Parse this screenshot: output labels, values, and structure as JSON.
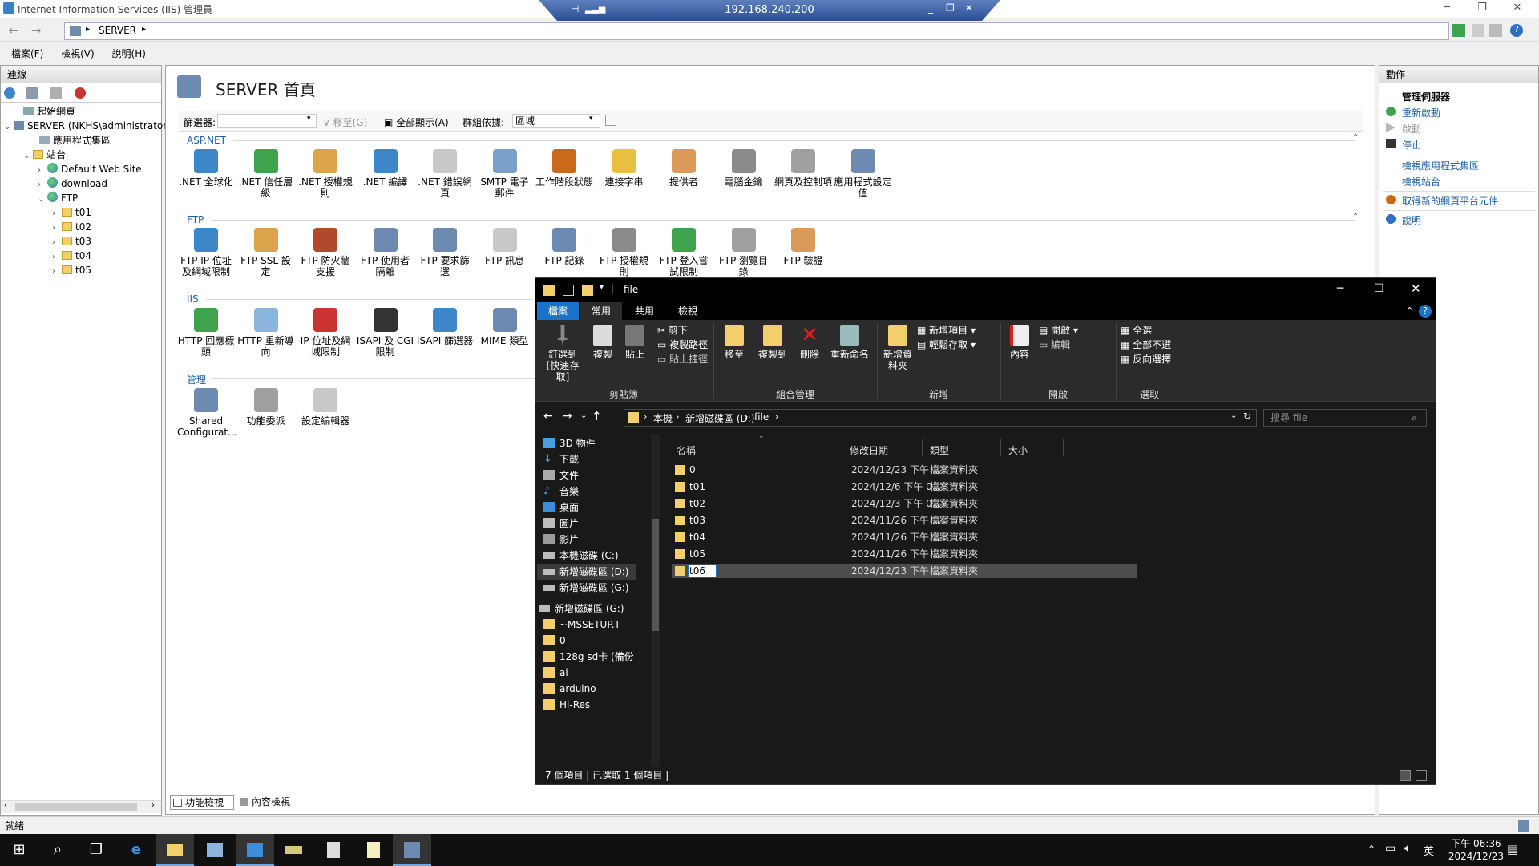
{
  "iis": {
    "title": "Internet Information Services (IIS) 管理員",
    "rdp_ip": "192.168.240.200",
    "address_path": "SERVER",
    "menu": [
      "檔案(F)",
      "檢視(V)",
      "說明(H)"
    ],
    "connections": {
      "header": "連線",
      "tree": [
        {
          "label": "起始網頁",
          "level": 1
        },
        {
          "label": "SERVER (NKHS\\administrator)",
          "level": 0
        },
        {
          "label": "應用程式集區",
          "level": 2
        },
        {
          "label": "站台",
          "level": 1
        },
        {
          "label": "Default Web Site",
          "level": 2
        },
        {
          "label": "download",
          "level": 2
        },
        {
          "label": "FTP",
          "level": 2
        },
        {
          "label": "t01",
          "level": 3
        },
        {
          "label": "t02",
          "level": 3
        },
        {
          "label": "t03",
          "level": 3
        },
        {
          "label": "t04",
          "level": 3
        },
        {
          "label": "t05",
          "level": 3
        }
      ]
    },
    "center": {
      "title": "SERVER 首頁",
      "filter_label": "篩選器:",
      "goto_label": "移至(G)",
      "show_all_label": "全部顯示(A)",
      "group_by_label": "群組依據:",
      "group_by_value": "區域",
      "sections": {
        "aspnet": {
          "label": "ASP.NET",
          "items": [
            ".NET 全球化",
            ".NET 信任層級",
            ".NET 授權規則",
            ".NET 編譯",
            ".NET 錯誤網頁",
            "SMTP 電子郵件",
            "工作階段狀態",
            "連接字串",
            "提供者",
            "電腦金鑰",
            "網頁及控制項",
            "應用程式設定值"
          ]
        },
        "ftp": {
          "label": "FTP",
          "items": [
            "FTP IP 位址及網域限制",
            "FTP SSL 設定",
            "FTP 防火牆支援",
            "FTP 使用者隔離",
            "FTP 要求篩選",
            "FTP 訊息",
            "FTP 記錄",
            "FTP 授權規則",
            "FTP 登入嘗試限制",
            "FTP 瀏覽目錄",
            "FTP 驗證"
          ]
        },
        "iis": {
          "label": "IIS",
          "items": [
            "HTTP 回應標頭",
            "HTTP 重新導向",
            "IP 位址及網域限制",
            "ISAPI 及 CGI 限制",
            "ISAPI 篩選器",
            "MIME 類型"
          ]
        },
        "mgmt": {
          "label": "管理",
          "items": [
            "Shared Configurat...",
            "功能委派",
            "設定編輯器"
          ]
        }
      },
      "bottom_tabs": [
        "功能檢視",
        "內容檢視"
      ]
    },
    "actions": {
      "header": "動作",
      "group_title": "管理伺服器",
      "items": [
        "重新啟動",
        "啟動",
        "停止",
        "檢視應用程式集區",
        "檢視站台",
        "取得新的網頁平台元件",
        "說明"
      ]
    },
    "status": "就緒"
  },
  "explorer": {
    "title": "file",
    "tabs": [
      "檔案",
      "常用",
      "共用",
      "檢視"
    ],
    "ribbon": {
      "pin": "釘選到 [快速存取]",
      "copy": "複製",
      "paste": "貼上",
      "cut": "剪下",
      "copy_path": "複製路徑",
      "paste_shortcut": "貼上捷徑",
      "clipboard": "剪貼簿",
      "move_to": "移至",
      "copy_to": "複製到",
      "delete": "刪除",
      "rename": "重新命名",
      "organize": "組合管理",
      "new_folder": "新增資料夾",
      "new_item": "新增項目",
      "easy_access": "輕鬆存取",
      "new_group": "新增",
      "properties": "內容",
      "open": "開啟",
      "edit": "編輯",
      "open_group": "開啟",
      "select_all": "全選",
      "select_none": "全部不選",
      "invert": "反向選擇",
      "select_group": "選取"
    },
    "path": [
      "本機",
      "新增磁碟區 (D:)",
      "file"
    ],
    "search_placeholder": "搜尋 file",
    "nav": [
      "3D 物件",
      "下載",
      "文件",
      "音樂",
      "桌面",
      "圖片",
      "影片",
      "本機磁碟 (C:)",
      "新增磁碟區 (D:)",
      "新增磁碟區 (G:)",
      "新增磁碟區 (G:)",
      "~MSSETUP.T",
      "0",
      "128g sd卡 (備份",
      "ai",
      "arduino",
      "Hi-Res"
    ],
    "columns": [
      "名稱",
      "修改日期",
      "類型",
      "大小"
    ],
    "rows": [
      {
        "name": "0",
        "date": "2024/12/23 下午 ...",
        "type": "檔案資料夾"
      },
      {
        "name": "t01",
        "date": "2024/12/6 下午 0...",
        "type": "檔案資料夾"
      },
      {
        "name": "t02",
        "date": "2024/12/3 下午 0...",
        "type": "檔案資料夾"
      },
      {
        "name": "t03",
        "date": "2024/11/26 下午 ...",
        "type": "檔案資料夾"
      },
      {
        "name": "t04",
        "date": "2024/11/26 下午 ...",
        "type": "檔案資料夾"
      },
      {
        "name": "t05",
        "date": "2024/11/26 下午 ...",
        "type": "檔案資料夾"
      },
      {
        "name": "t06",
        "date": "2024/12/23 下午 ...",
        "type": "檔案資料夾"
      }
    ],
    "status": "7 個項目  |  已選取 1 個項目  |"
  },
  "taskbar": {
    "time": "下午 06:36",
    "date": "2024/12/23",
    "ime": "英"
  }
}
